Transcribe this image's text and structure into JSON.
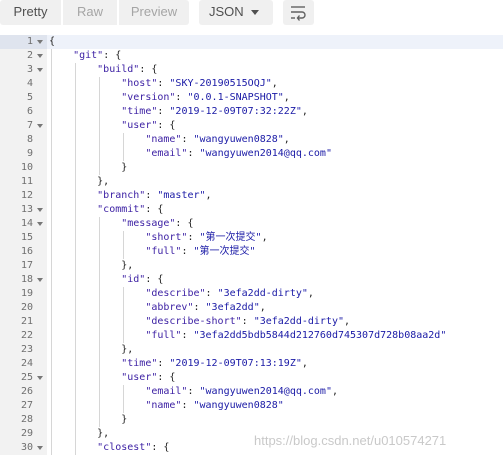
{
  "toolbar": {
    "view_modes": [
      "Pretty",
      "Raw",
      "Preview"
    ],
    "active_mode": "Pretty",
    "format_label": "JSON",
    "wrap_icon": "wrap-lines-icon"
  },
  "editor": {
    "lines": [
      {
        "n": "1",
        "indent": 0,
        "fold": true,
        "parts": [
          [
            "p",
            "{"
          ]
        ]
      },
      {
        "n": "2",
        "indent": 1,
        "fold": true,
        "parts": [
          [
            "k",
            "\"git\""
          ],
          [
            "p",
            ": {"
          ]
        ]
      },
      {
        "n": "3",
        "indent": 2,
        "fold": true,
        "parts": [
          [
            "k",
            "\"build\""
          ],
          [
            "p",
            ": {"
          ]
        ]
      },
      {
        "n": "4",
        "indent": 3,
        "fold": false,
        "parts": [
          [
            "k",
            "\"host\""
          ],
          [
            "p",
            ": "
          ],
          [
            "s",
            "\"SKY-20190515OQJ\""
          ],
          [
            "p",
            ","
          ]
        ]
      },
      {
        "n": "5",
        "indent": 3,
        "fold": false,
        "parts": [
          [
            "k",
            "\"version\""
          ],
          [
            "p",
            ": "
          ],
          [
            "s",
            "\"0.0.1-SNAPSHOT\""
          ],
          [
            "p",
            ","
          ]
        ]
      },
      {
        "n": "6",
        "indent": 3,
        "fold": false,
        "parts": [
          [
            "k",
            "\"time\""
          ],
          [
            "p",
            ": "
          ],
          [
            "s",
            "\"2019-12-09T07:32:22Z\""
          ],
          [
            "p",
            ","
          ]
        ]
      },
      {
        "n": "7",
        "indent": 3,
        "fold": true,
        "parts": [
          [
            "k",
            "\"user\""
          ],
          [
            "p",
            ": {"
          ]
        ]
      },
      {
        "n": "8",
        "indent": 4,
        "fold": false,
        "parts": [
          [
            "k",
            "\"name\""
          ],
          [
            "p",
            ": "
          ],
          [
            "s",
            "\"wangyuwen0828\""
          ],
          [
            "p",
            ","
          ]
        ]
      },
      {
        "n": "9",
        "indent": 4,
        "fold": false,
        "parts": [
          [
            "k",
            "\"email\""
          ],
          [
            "p",
            ": "
          ],
          [
            "s",
            "\"wangyuwen2014@qq.com\""
          ]
        ]
      },
      {
        "n": "10",
        "indent": 3,
        "fold": false,
        "parts": [
          [
            "p",
            "}"
          ]
        ]
      },
      {
        "n": "11",
        "indent": 2,
        "fold": false,
        "parts": [
          [
            "p",
            "},"
          ]
        ]
      },
      {
        "n": "12",
        "indent": 2,
        "fold": false,
        "parts": [
          [
            "k",
            "\"branch\""
          ],
          [
            "p",
            ": "
          ],
          [
            "s",
            "\"master\""
          ],
          [
            "p",
            ","
          ]
        ]
      },
      {
        "n": "13",
        "indent": 2,
        "fold": true,
        "parts": [
          [
            "k",
            "\"commit\""
          ],
          [
            "p",
            ": {"
          ]
        ]
      },
      {
        "n": "14",
        "indent": 3,
        "fold": true,
        "parts": [
          [
            "k",
            "\"message\""
          ],
          [
            "p",
            ": {"
          ]
        ]
      },
      {
        "n": "15",
        "indent": 4,
        "fold": false,
        "parts": [
          [
            "k",
            "\"short\""
          ],
          [
            "p",
            ": "
          ],
          [
            "s",
            "\"第一次提交\""
          ],
          [
            "p",
            ","
          ]
        ]
      },
      {
        "n": "16",
        "indent": 4,
        "fold": false,
        "parts": [
          [
            "k",
            "\"full\""
          ],
          [
            "p",
            ": "
          ],
          [
            "s",
            "\"第一次提交\""
          ]
        ]
      },
      {
        "n": "17",
        "indent": 3,
        "fold": false,
        "parts": [
          [
            "p",
            "},"
          ]
        ]
      },
      {
        "n": "18",
        "indent": 3,
        "fold": true,
        "parts": [
          [
            "k",
            "\"id\""
          ],
          [
            "p",
            ": {"
          ]
        ]
      },
      {
        "n": "19",
        "indent": 4,
        "fold": false,
        "parts": [
          [
            "k",
            "\"describe\""
          ],
          [
            "p",
            ": "
          ],
          [
            "s",
            "\"3efa2dd-dirty\""
          ],
          [
            "p",
            ","
          ]
        ]
      },
      {
        "n": "20",
        "indent": 4,
        "fold": false,
        "parts": [
          [
            "k",
            "\"abbrev\""
          ],
          [
            "p",
            ": "
          ],
          [
            "s",
            "\"3efa2dd\""
          ],
          [
            "p",
            ","
          ]
        ]
      },
      {
        "n": "21",
        "indent": 4,
        "fold": false,
        "parts": [
          [
            "k",
            "\"describe-short\""
          ],
          [
            "p",
            ": "
          ],
          [
            "s",
            "\"3efa2dd-dirty\""
          ],
          [
            "p",
            ","
          ]
        ]
      },
      {
        "n": "22",
        "indent": 4,
        "fold": false,
        "parts": [
          [
            "k",
            "\"full\""
          ],
          [
            "p",
            ": "
          ],
          [
            "s",
            "\"3efa2dd5bdb5844d212760d745307d728b08aa2d\""
          ]
        ]
      },
      {
        "n": "23",
        "indent": 3,
        "fold": false,
        "parts": [
          [
            "p",
            "},"
          ]
        ]
      },
      {
        "n": "24",
        "indent": 3,
        "fold": false,
        "parts": [
          [
            "k",
            "\"time\""
          ],
          [
            "p",
            ": "
          ],
          [
            "s",
            "\"2019-12-09T07:13:19Z\""
          ],
          [
            "p",
            ","
          ]
        ]
      },
      {
        "n": "25",
        "indent": 3,
        "fold": true,
        "parts": [
          [
            "k",
            "\"user\""
          ],
          [
            "p",
            ": {"
          ]
        ]
      },
      {
        "n": "26",
        "indent": 4,
        "fold": false,
        "parts": [
          [
            "k",
            "\"email\""
          ],
          [
            "p",
            ": "
          ],
          [
            "s",
            "\"wangyuwen2014@qq.com\""
          ],
          [
            "p",
            ","
          ]
        ]
      },
      {
        "n": "27",
        "indent": 4,
        "fold": false,
        "parts": [
          [
            "k",
            "\"name\""
          ],
          [
            "p",
            ": "
          ],
          [
            "s",
            "\"wangyuwen0828\""
          ]
        ]
      },
      {
        "n": "28",
        "indent": 3,
        "fold": false,
        "parts": [
          [
            "p",
            "}"
          ]
        ]
      },
      {
        "n": "29",
        "indent": 2,
        "fold": false,
        "parts": [
          [
            "p",
            "},"
          ]
        ]
      },
      {
        "n": "30",
        "indent": 2,
        "fold": true,
        "parts": [
          [
            "k",
            "\"closest\""
          ],
          [
            "p",
            ": {"
          ]
        ]
      }
    ]
  },
  "watermark": "https://blog.csdn.net/u010574271"
}
